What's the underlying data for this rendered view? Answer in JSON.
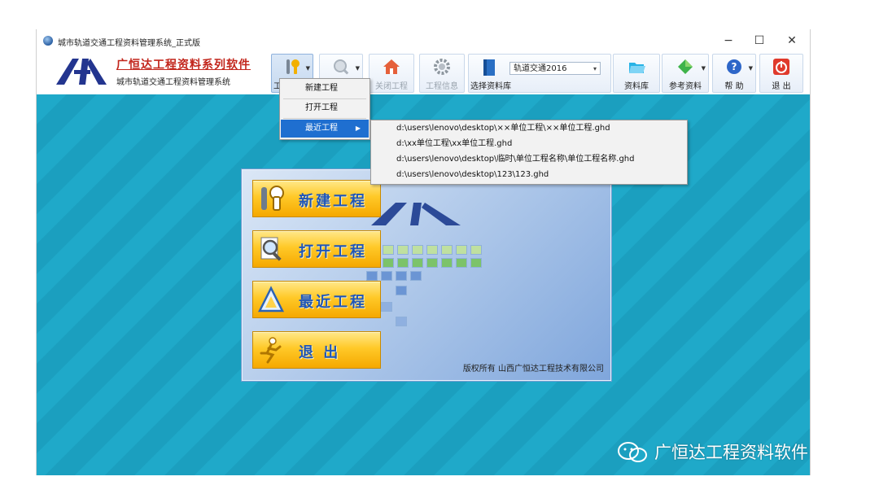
{
  "window": {
    "title": "城市轨道交通工程资料管理系统_正式版",
    "controls": {
      "minimize": "−",
      "maximize": "☐",
      "close": "✕"
    }
  },
  "logo": {
    "mark_text": "GHD",
    "title": "广恒达工程资料系列软件",
    "subtitle": "城市轨道交通工程资料管理系统"
  },
  "toolbar": {
    "project_label": "工",
    "close_project_label": "关闭工程",
    "project_info_label": "工程信息",
    "select_library_label": "选择资料库",
    "library_value": "轨道交通2016",
    "library_btn_label": "资料库",
    "reference_label": "参考资料",
    "help_label": "帮 助",
    "exit_label": "退 出"
  },
  "project_menu": {
    "items": [
      {
        "label": "新建工程"
      },
      {
        "label": "打开工程"
      },
      {
        "label": "最近工程"
      }
    ]
  },
  "recent_projects": [
    "d:\\users\\lenovo\\desktop\\××单位工程\\××单位工程.ghd",
    "d:\\xx单位工程\\xx单位工程.ghd",
    "d:\\users\\lenovo\\desktop\\临时\\单位工程名称\\单位工程名称.ghd",
    "d:\\users\\lenovo\\desktop\\123\\123.ghd"
  ],
  "panel": {
    "buttons": {
      "new": "新建工程",
      "open": "打开工程",
      "recent": "最近工程",
      "exit": "退  出"
    },
    "copyright": "版权所有  山西广恒达工程技术有限公司"
  },
  "watermark": {
    "text": "广恒达工程资料软件"
  },
  "colors": {
    "workspace": "#1fa9c9",
    "menu_highlight": "#1f6fd0",
    "button_gold": "#ffc928",
    "button_text": "#1f56b8",
    "logo_red": "#c2261c"
  },
  "icons": [
    "app-globe-icon",
    "tools-icon",
    "search-icon",
    "home-icon",
    "gear-icon",
    "book-icon",
    "folder-icon",
    "diamond-icon",
    "help-icon",
    "power-icon",
    "wechat-icon"
  ]
}
